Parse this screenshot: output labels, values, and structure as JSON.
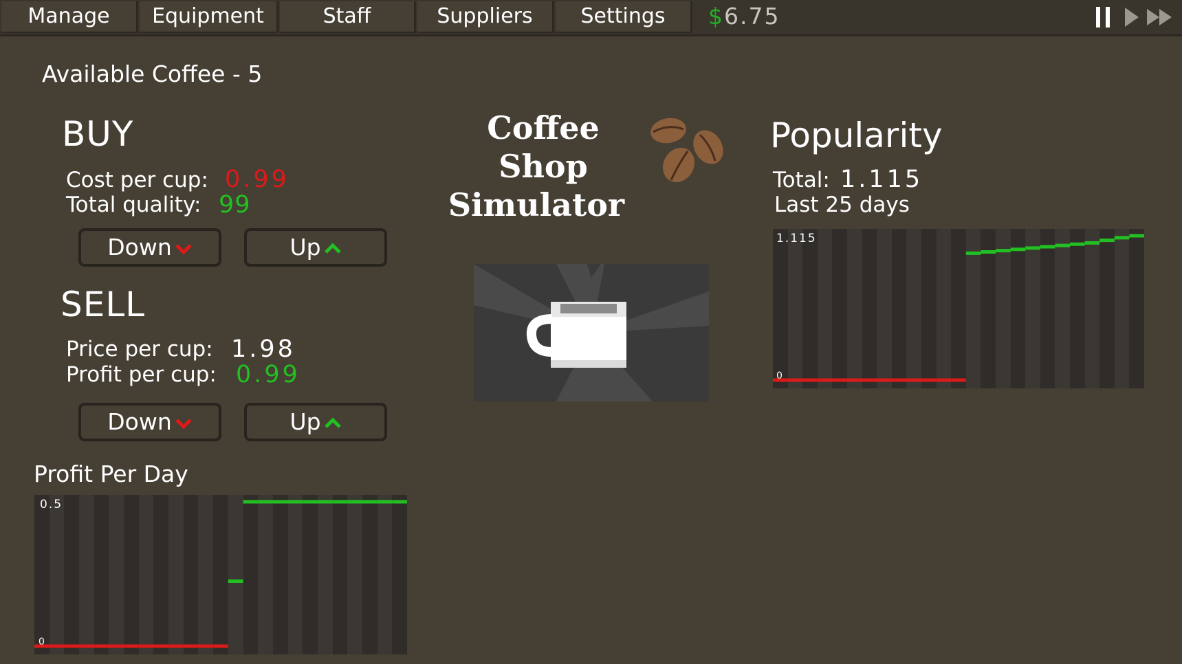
{
  "tabs": [
    {
      "label": "Manage"
    },
    {
      "label": "Equipment"
    },
    {
      "label": "Staff"
    },
    {
      "label": "Suppliers"
    },
    {
      "label": "Settings"
    }
  ],
  "money": {
    "currency": "$",
    "amount": "6.75"
  },
  "controls": {
    "pause": "pause-icon",
    "play": "play-icon",
    "fast_forward": "fast-forward-icon"
  },
  "available": "Available Coffee - 5",
  "buy": {
    "heading": "BUY",
    "cost_label": "Cost per cup:",
    "cost_value": "0.99",
    "quality_label": "Total quality:",
    "quality_value": "99",
    "down_label": "Down",
    "up_label": "Up"
  },
  "sell": {
    "heading": "SELL",
    "price_label": "Price per cup:",
    "price_value": "1.98",
    "profit_label": "Profit per cup:",
    "profit_value": "0.99",
    "down_label": "Down",
    "up_label": "Up"
  },
  "game_title": {
    "line1": "Coffee Shop",
    "line2": "Simulator"
  },
  "popularity": {
    "heading": "Popularity",
    "total_label": "Total:",
    "total_value": "1.115",
    "period": "Last 25 days"
  },
  "profit": {
    "heading": "Profit Per Day"
  },
  "colors": {
    "background": "#453f34",
    "positive": "#22c022",
    "negative": "#dd1a1a",
    "accent_money": "#22b022"
  },
  "chart_data": [
    {
      "type": "line",
      "title": "Popularity",
      "y_max_label": "1.115",
      "y_min_label": "0",
      "ylim": [
        0,
        1.115
      ],
      "x": [
        1,
        2,
        3,
        4,
        5,
        6,
        7,
        8,
        9,
        10,
        11,
        12,
        13,
        14,
        15,
        16,
        17,
        18,
        19,
        20,
        21,
        22,
        23,
        24,
        25
      ],
      "values": [
        0,
        0,
        0,
        0,
        0,
        0,
        0,
        0,
        0,
        0,
        0,
        0,
        0,
        0.98,
        0.99,
        1.0,
        1.01,
        1.02,
        1.03,
        1.04,
        1.05,
        1.06,
        1.08,
        1.1,
        1.115
      ],
      "grid": true
    },
    {
      "type": "line",
      "title": "Profit Per Day",
      "y_max_label": "0.5",
      "y_min_label": "0",
      "ylim": [
        0,
        0.5
      ],
      "x": [
        1,
        2,
        3,
        4,
        5,
        6,
        7,
        8,
        9,
        10,
        11,
        12,
        13,
        14,
        15,
        16,
        17,
        18,
        19,
        20,
        21,
        22,
        23,
        24,
        25
      ],
      "values": [
        0,
        0,
        0,
        0,
        0,
        0,
        0,
        0,
        0,
        0,
        0,
        0,
        0,
        0.225,
        0.5,
        0.5,
        0.5,
        0.5,
        0.5,
        0.5,
        0.5,
        0.5,
        0.5,
        0.5,
        0.5
      ],
      "grid": true
    }
  ]
}
